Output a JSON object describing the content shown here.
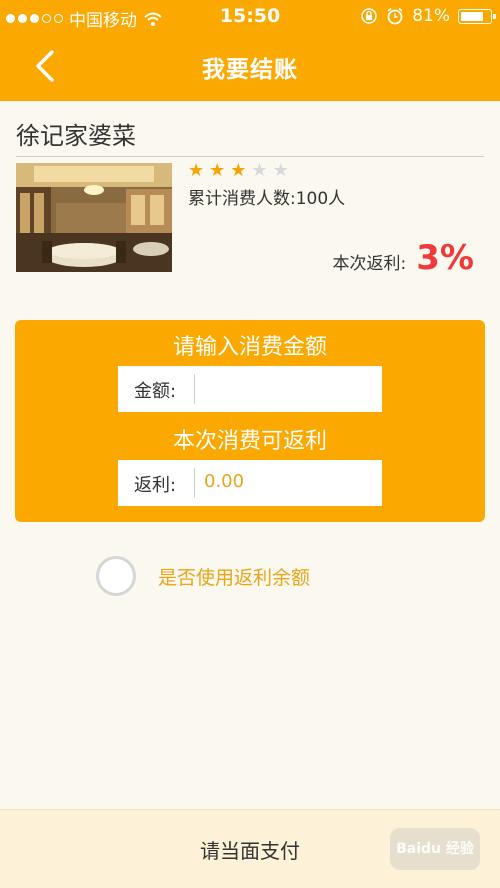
{
  "status_bar": {
    "carrier": "中国移动",
    "time": "15:50",
    "battery": "81%",
    "battery_level": 0.81
  },
  "nav": {
    "title": "我要结账",
    "back_icon": "chevron-left-icon"
  },
  "shop": {
    "name": "徐记家婆菜",
    "rating": 3,
    "rating_max": 5,
    "consumers_text": "累计消费人数:100人",
    "rebate_label": "本次返利:",
    "rebate_value": "3%"
  },
  "form": {
    "amount_heading": "请输入消费金额",
    "amount_label": "金额:",
    "amount_value": "",
    "rebate_heading": "本次消费可返利",
    "rebate_label": "返利:",
    "rebate_value": "0.00"
  },
  "use_balance": {
    "label": "是否使用返利余额",
    "checked": false
  },
  "bottom": {
    "pay_label": "请当面支付",
    "watermark": "Baidu 经验"
  },
  "colors": {
    "accent": "#fba800",
    "rebate_red": "#ee3a3a",
    "link_orange": "#e9a51a"
  }
}
